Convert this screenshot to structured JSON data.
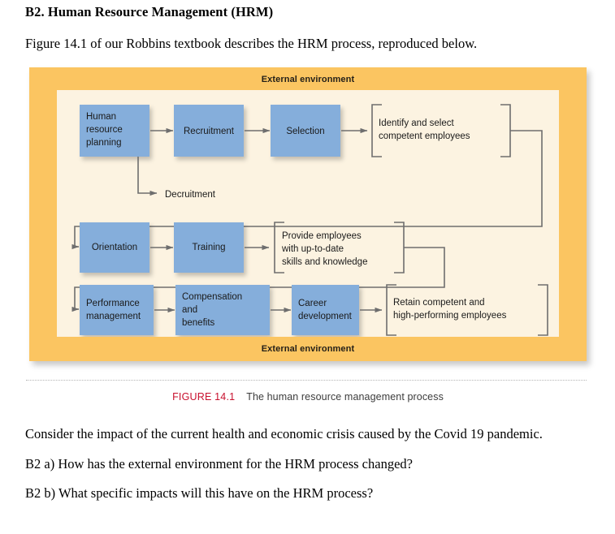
{
  "document": {
    "heading": "B2.  Human Resource Management (HRM)",
    "intro": "Figure 14.1 of our Robbins textbook describes the HRM process, reproduced below.",
    "consider": "Consider the impact of the current health and economic crisis caused by the Covid 19 pandemic.",
    "question_a": "B2 a)  How has the external environment for the HRM process changed?",
    "question_b": "B2 b)  What specific impacts will this have on the HRM process?"
  },
  "figure": {
    "environment_label_top": "External environment",
    "environment_label_bottom": "External environment",
    "caption_number": "FIGURE 14.1",
    "caption_text": "The human resource management process",
    "colors": {
      "panel_orange": "#fbc561",
      "inner_cream": "#fcf3e1",
      "box_blue": "#85aedb",
      "connector_gray": "#6e6e6e",
      "caption_red": "#c8102e"
    },
    "rows": [
      {
        "name": "staffing",
        "boxes": [
          {
            "id": "human-resource-planning",
            "lines": [
              "Human",
              "resource",
              "planning"
            ]
          },
          {
            "id": "recruitment",
            "lines": [
              "Recruitment"
            ]
          },
          {
            "id": "selection",
            "lines": [
              "Selection"
            ]
          }
        ],
        "branch_label": "Decruitment",
        "outcome": {
          "id": "identify-and-select",
          "lines": [
            "Identify and select",
            "competent employees"
          ]
        }
      },
      {
        "name": "training-and-development",
        "boxes": [
          {
            "id": "orientation",
            "lines": [
              "Orientation"
            ]
          },
          {
            "id": "training",
            "lines": [
              "Training"
            ]
          }
        ],
        "outcome": {
          "id": "provide-employees",
          "lines": [
            "Provide employees",
            "with up-to-date",
            "skills and knowledge"
          ]
        }
      },
      {
        "name": "retention",
        "boxes": [
          {
            "id": "performance-management",
            "lines": [
              "Performance",
              "management"
            ]
          },
          {
            "id": "compensation-and-benefits",
            "lines": [
              "Compensation",
              "and",
              "benefits"
            ]
          },
          {
            "id": "career-development",
            "lines": [
              "Career",
              "development"
            ]
          }
        ],
        "outcome": {
          "id": "retain-competent",
          "lines": [
            "Retain competent and",
            "high-performing employees"
          ]
        }
      }
    ]
  }
}
